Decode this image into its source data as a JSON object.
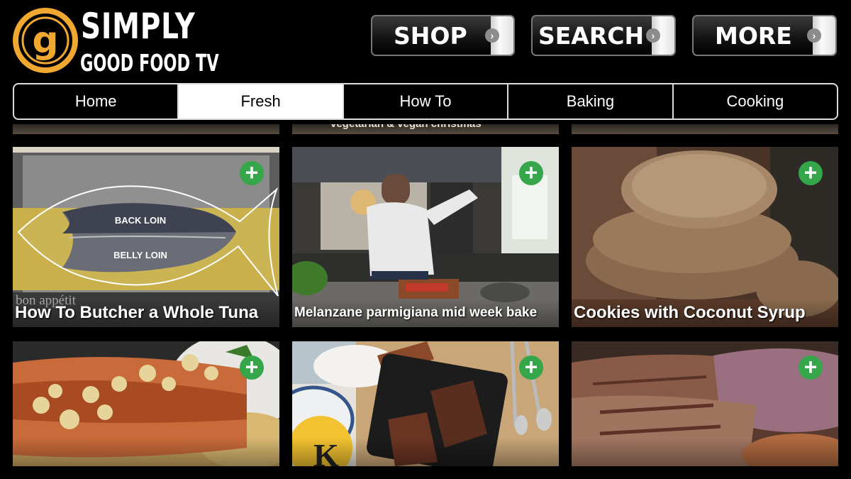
{
  "logo": {
    "title": "SIMPLY",
    "subtitle": "GOOD FOOD TV",
    "mark_letter": "g",
    "brand_color": "#f0a830"
  },
  "toolbar": {
    "shop_label": "SHOP",
    "search_label": "SEARCH",
    "more_label": "MORE"
  },
  "tabs": [
    {
      "label": "Home",
      "active": false
    },
    {
      "label": "Fresh",
      "active": true
    },
    {
      "label": "How To",
      "active": false
    },
    {
      "label": "Baking",
      "active": false
    },
    {
      "label": "Cooking",
      "active": false
    }
  ],
  "partial_row": {
    "middle_caption": "vegetarian & vegan christmas"
  },
  "videos": [
    {
      "title": "How To Butcher a Whole Tuna",
      "thumb": {
        "label_top": "BACK LOIN",
        "label_bottom": "BELLY LOIN",
        "watermark": "bon appétit"
      }
    },
    {
      "title": "Melanzane parmigiana mid week bake"
    },
    {
      "title": "Cookies with Coconut Syrup"
    },
    {
      "title": ""
    },
    {
      "title": "",
      "thumb": {
        "badge": "K"
      }
    },
    {
      "title": ""
    }
  ],
  "add_icon": "plus-circle-icon",
  "colors": {
    "add": "#35a64a",
    "background": "#000000"
  }
}
